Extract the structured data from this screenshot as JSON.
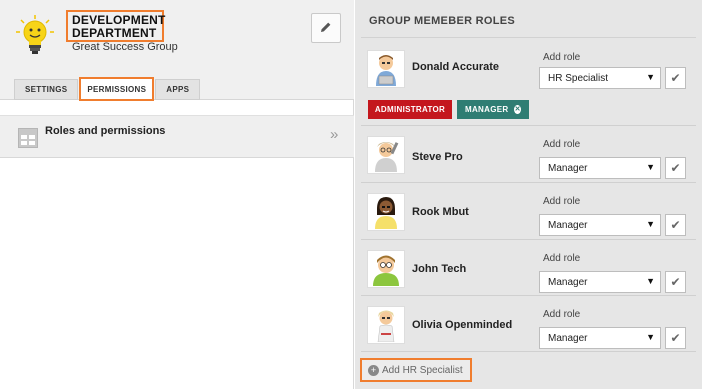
{
  "group": {
    "title_line1": "DEVELOPMENT",
    "title_line2": "DEPARTMENT",
    "subtitle": "Great Success Group"
  },
  "tabs": [
    {
      "label": "SETTINGS"
    },
    {
      "label": "PERMISSIONS"
    },
    {
      "label": "APPS"
    }
  ],
  "active_tab": "PERMISSIONS",
  "left_section": {
    "title": "Roles and permissions"
  },
  "roles_panel": {
    "heading": "GROUP MEMEBER ROLES",
    "members": [
      {
        "name": "Donald Accurate",
        "add_role_label": "Add role",
        "selected_role": "HR Specialist"
      },
      {
        "name": "Steve Pro",
        "add_role_label": "Add role",
        "selected_role": "Manager"
      },
      {
        "name": "Rook Mbut",
        "add_role_label": "Add role",
        "selected_role": "Manager"
      },
      {
        "name": "John Tech",
        "add_role_label": "Add role",
        "selected_role": "Manager"
      },
      {
        "name": "Olivia Openminded",
        "add_role_label": "Add role",
        "selected_role": "Manager"
      }
    ],
    "badges": [
      {
        "label": "ADMINISTRATOR",
        "color": "#c4171d"
      },
      {
        "label": "MANAGER",
        "color": "#2f7d73"
      }
    ],
    "add_button": "Add HR Specialist"
  },
  "colors": {
    "highlight": "#f07d2e",
    "admin_badge": "#c4171d",
    "manager_badge": "#2f7d73"
  },
  "icons": [
    "lightbulb-logo-icon",
    "pencil-icon",
    "roles-grid-icon",
    "double-chevron-right-icon",
    "dropdown-arrow-icon",
    "checkmark-icon",
    "remove-x-icon",
    "plus-circle-icon"
  ]
}
